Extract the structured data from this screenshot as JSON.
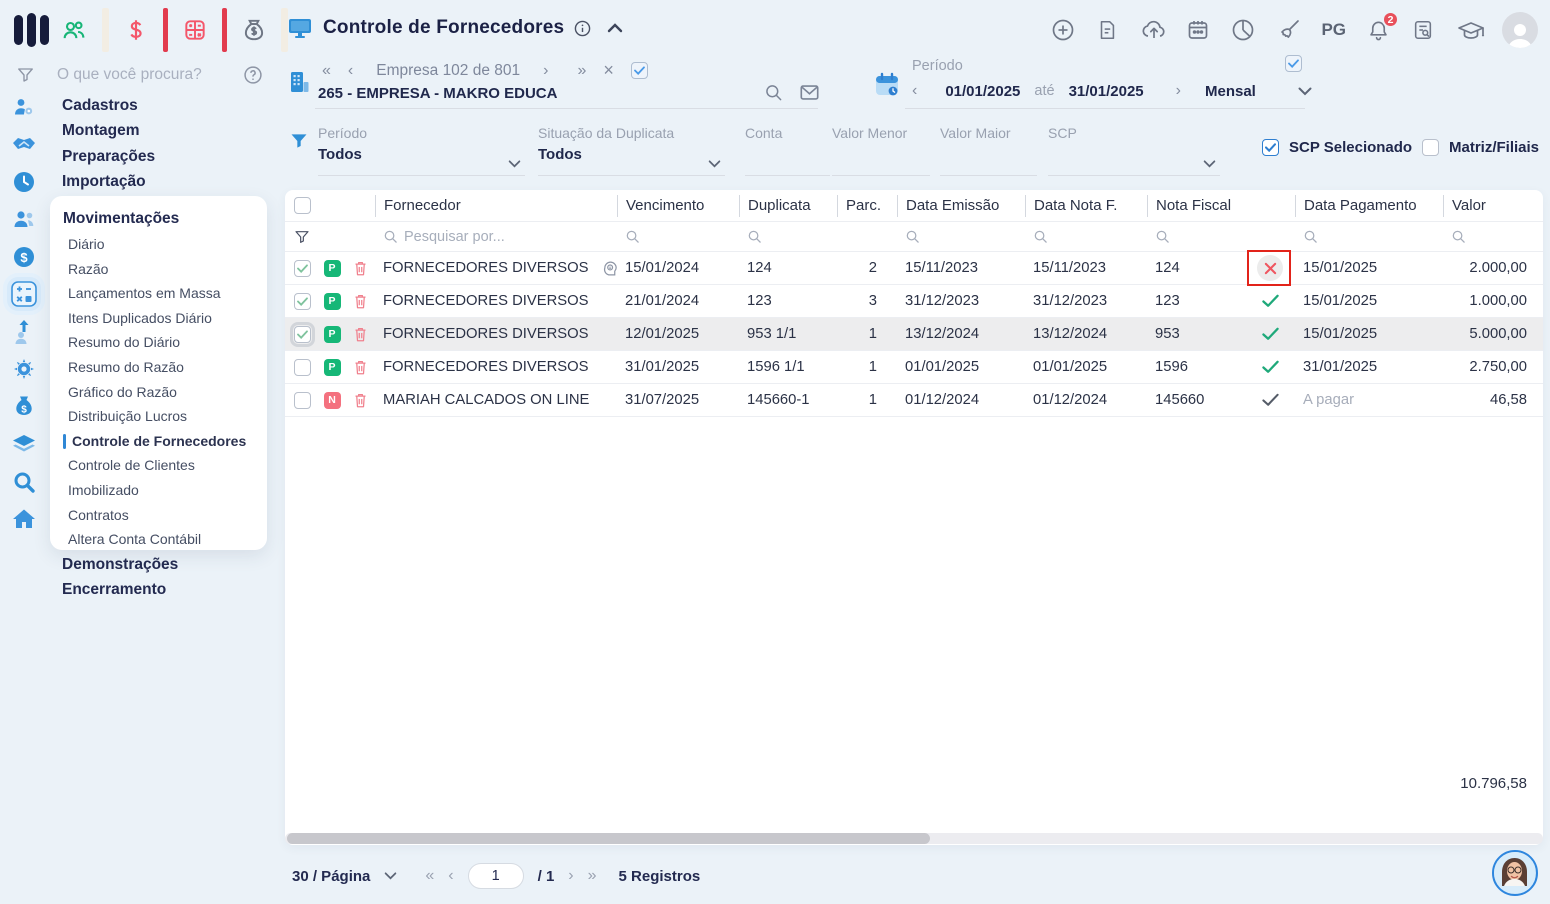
{
  "topbar": {
    "title": "Controle de Fornecedores",
    "pg": "PG",
    "notification_count": "2"
  },
  "sidebar_search": {
    "placeholder": "O que você procura?"
  },
  "sidebar": {
    "items_top": [
      "Cadastros",
      "Montagem",
      "Preparações",
      "Importação"
    ],
    "popup_title": "Movimentações",
    "popup_items": [
      "Diário",
      "Razão",
      "Lançamentos em Massa",
      "Itens Duplicados Diário",
      "Resumo do Diário",
      "Resumo do Razão",
      "Gráfico do Razão",
      "Distribuição Lucros",
      "Controle de Fornecedores",
      "Controle de Clientes",
      "Imobilizado",
      "Contratos",
      "Altera Conta Contábil"
    ],
    "active_item": "Controle de Fornecedores",
    "items_bottom": [
      "Demonstrações",
      "Encerramento"
    ]
  },
  "company_nav": {
    "position": "Empresa 102 de 801",
    "name": "265 - EMPRESA - MAKRO EDUCA"
  },
  "period": {
    "label": "Período",
    "start": "01/01/2025",
    "separator": "até",
    "end": "31/01/2025",
    "mode": "Mensal"
  },
  "filters": {
    "periodo_label": "Período",
    "periodo_value": "Todos",
    "situacao_label": "Situação da Duplicata",
    "situacao_value": "Todos",
    "conta_label": "Conta",
    "valor_menor_label": "Valor Menor",
    "valor_maior_label": "Valor Maior",
    "scp_label": "SCP",
    "scp_selecionado_label": "SCP Selecionado",
    "matriz_filiais_label": "Matriz/Filiais"
  },
  "table": {
    "headers": {
      "fornecedor": "Fornecedor",
      "vencimento": "Vencimento",
      "duplicata": "Duplicata",
      "parc": "Parc.",
      "data_emissao": "Data Emissão",
      "data_nota_f": "Data Nota F.",
      "nota_fiscal": "Nota Fiscal",
      "data_pagamento": "Data Pagamento",
      "valor": "Valor"
    },
    "search_placeholder": "Pesquisar por...",
    "rows": [
      {
        "checked": true,
        "situacao": "P",
        "fornecedor": "FORNECEDORES DIVERSOS",
        "vencimento": "15/01/2024",
        "duplicata": "124",
        "parc": "2",
        "data_emissao": "15/11/2023",
        "data_nota_f": "15/11/2023",
        "nota_fiscal": "124",
        "pago": "nao",
        "data_pagamento": "15/01/2025",
        "valor": "2.000,00"
      },
      {
        "checked": true,
        "situacao": "P",
        "fornecedor": "FORNECEDORES DIVERSOS",
        "vencimento": "21/01/2024",
        "duplicata": "123",
        "parc": "3",
        "data_emissao": "31/12/2023",
        "data_nota_f": "31/12/2023",
        "nota_fiscal": "123",
        "pago": "sim",
        "data_pagamento": "15/01/2025",
        "valor": "1.000,00"
      },
      {
        "checked": true,
        "situacao": "P",
        "fornecedor": "FORNECEDORES DIVERSOS",
        "vencimento": "12/01/2025",
        "duplicata": "953 1/1",
        "parc": "1",
        "data_emissao": "13/12/2024",
        "data_nota_f": "13/12/2024",
        "nota_fiscal": "953",
        "pago": "sim",
        "data_pagamento": "15/01/2025",
        "valor": "5.000,00"
      },
      {
        "checked": false,
        "situacao": "P",
        "fornecedor": "FORNECEDORES DIVERSOS",
        "vencimento": "31/01/2025",
        "duplicata": "1596 1/1",
        "parc": "1",
        "data_emissao": "01/01/2025",
        "data_nota_f": "01/01/2025",
        "nota_fiscal": "1596",
        "pago": "sim",
        "data_pagamento": "31/01/2025",
        "valor": "2.750,00"
      },
      {
        "checked": false,
        "situacao": "N",
        "fornecedor": "MARIAH CALCADOS ON LINE",
        "vencimento": "31/07/2025",
        "duplicata": "145660-1",
        "parc": "1",
        "data_emissao": "01/12/2024",
        "data_nota_f": "01/12/2024",
        "nota_fiscal": "145660",
        "pago": "pendente",
        "data_pagamento": "A pagar",
        "valor": "46,58"
      }
    ],
    "total": "10.796,58"
  },
  "pagination": {
    "per_page": "30 / Página",
    "current_page": "1",
    "total_pages": "/ 1",
    "records": "5 Registros"
  },
  "colors": {
    "accent_blue": "#2f87d5",
    "green": "#16b777",
    "red": "#e8505b",
    "annotation_red": "#e2231a",
    "navy": "#1b2145"
  }
}
